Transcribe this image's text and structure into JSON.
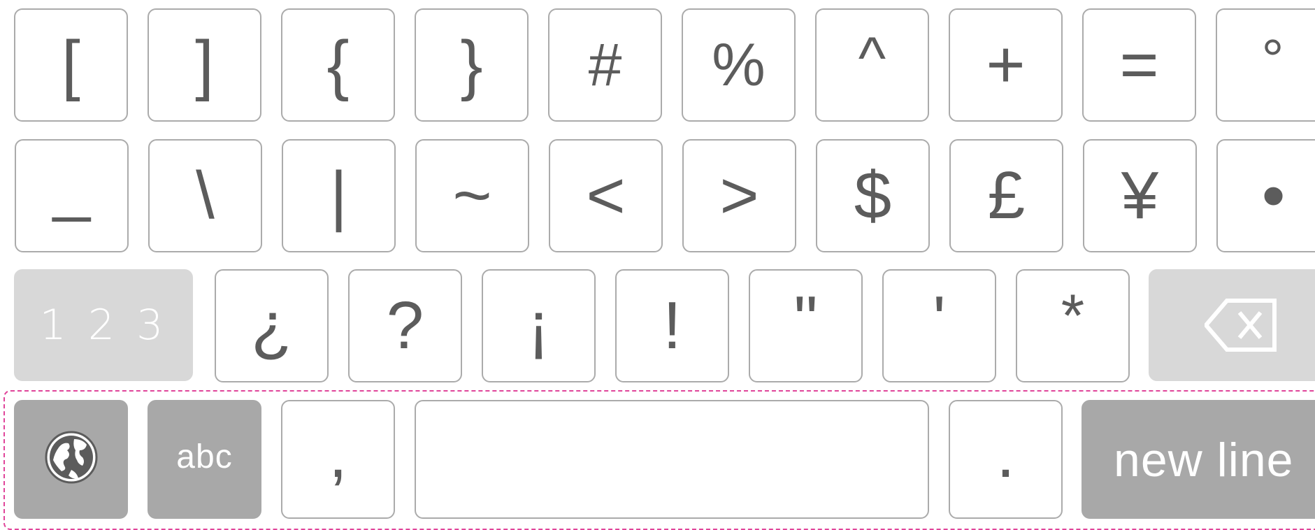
{
  "keyboard": {
    "row1": [
      "[",
      "]",
      "{",
      "}",
      "#",
      "%",
      "^",
      "+",
      "=",
      "°"
    ],
    "row2": [
      "_",
      "\\",
      "|",
      "~",
      "<",
      ">",
      "$",
      "£",
      "¥",
      "•"
    ],
    "row3": {
      "numbers_label": "1 2 3",
      "keys": [
        "¿",
        "?",
        "¡",
        "!",
        "\"",
        "'",
        "*"
      ],
      "backspace_icon": "backspace-icon"
    },
    "row4": {
      "globe_icon": "globe-icon",
      "abc_label": "abc",
      "comma": ",",
      "space": "",
      "period": ".",
      "newline_label": "new line"
    }
  },
  "colors": {
    "key_border": "#ababab",
    "key_text": "#5c5c5c",
    "light_modifier_bg": "#d8d8d8",
    "dark_modifier_bg": "#a8a8a8",
    "focus_dash": "#e0459a"
  }
}
